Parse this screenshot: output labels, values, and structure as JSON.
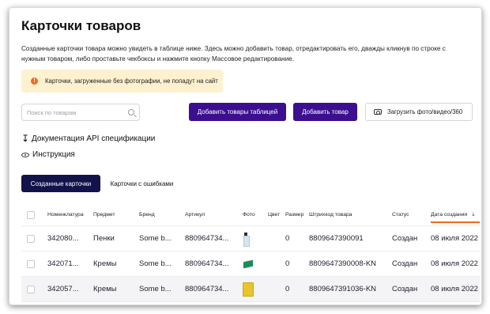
{
  "page": {
    "title": "Карточки товаров",
    "description": "Созданные карточки товара можно увидеть в таблице ниже. Здесь можно добавить товар, отредактировать его, дважды кликнув по строке с нужным товаром, либо проставьте чекбоксы и нажмите кнопку Массовое редактирование."
  },
  "alert": {
    "text": "Карточки, загруженные без фотографии, не попадут на сайт",
    "icon": "exclamation-icon",
    "color": "#fdf1d0"
  },
  "toolbar": {
    "search_placeholder": "Поиск по товарам",
    "add_table_label": "Добавить товары таблицей",
    "add_product_label": "Добавить товар",
    "upload_label": "Загрузить фото/видео/360",
    "accent_color": "#3b0f8f"
  },
  "links": {
    "api_docs": "Документация API спецификации",
    "instructions": "Инструкция"
  },
  "tabs": [
    {
      "label": "Созданные карточки",
      "active": true
    },
    {
      "label": "Карточки с ошибками",
      "active": false
    }
  ],
  "table": {
    "columns": {
      "nomenclature": "Номенклатура",
      "subject": "Предмет",
      "brand": "Бренд",
      "article": "Артикул",
      "photo": "Фото",
      "color": "Цвет",
      "size": "Размер",
      "barcode": "Штрихкод товара",
      "status": "Статус",
      "created": "Дата создания"
    },
    "rows": [
      {
        "nomenclature": "342080...",
        "subject": "Пенки",
        "brand": "Some b...",
        "article": "880964734...",
        "photo": "bottle",
        "color": "",
        "size": "0",
        "barcode": "8809647390091",
        "status": "Создан",
        "created": "08 июля 2022"
      },
      {
        "nomenclature": "342071...",
        "subject": "Кремы",
        "brand": "Some b...",
        "article": "880964734...",
        "photo": "cream-tube",
        "color": "",
        "size": "0",
        "barcode": "8809647390008-KN",
        "status": "Создан",
        "created": "08 июля 2022"
      },
      {
        "nomenclature": "342057...",
        "subject": "Кремы",
        "brand": "Some b...",
        "article": "880964734...",
        "photo": "yellow-box",
        "color": "",
        "size": "0",
        "barcode": "8809647391036-KN",
        "status": "Создан",
        "created": "08 июля 2022"
      }
    ]
  }
}
